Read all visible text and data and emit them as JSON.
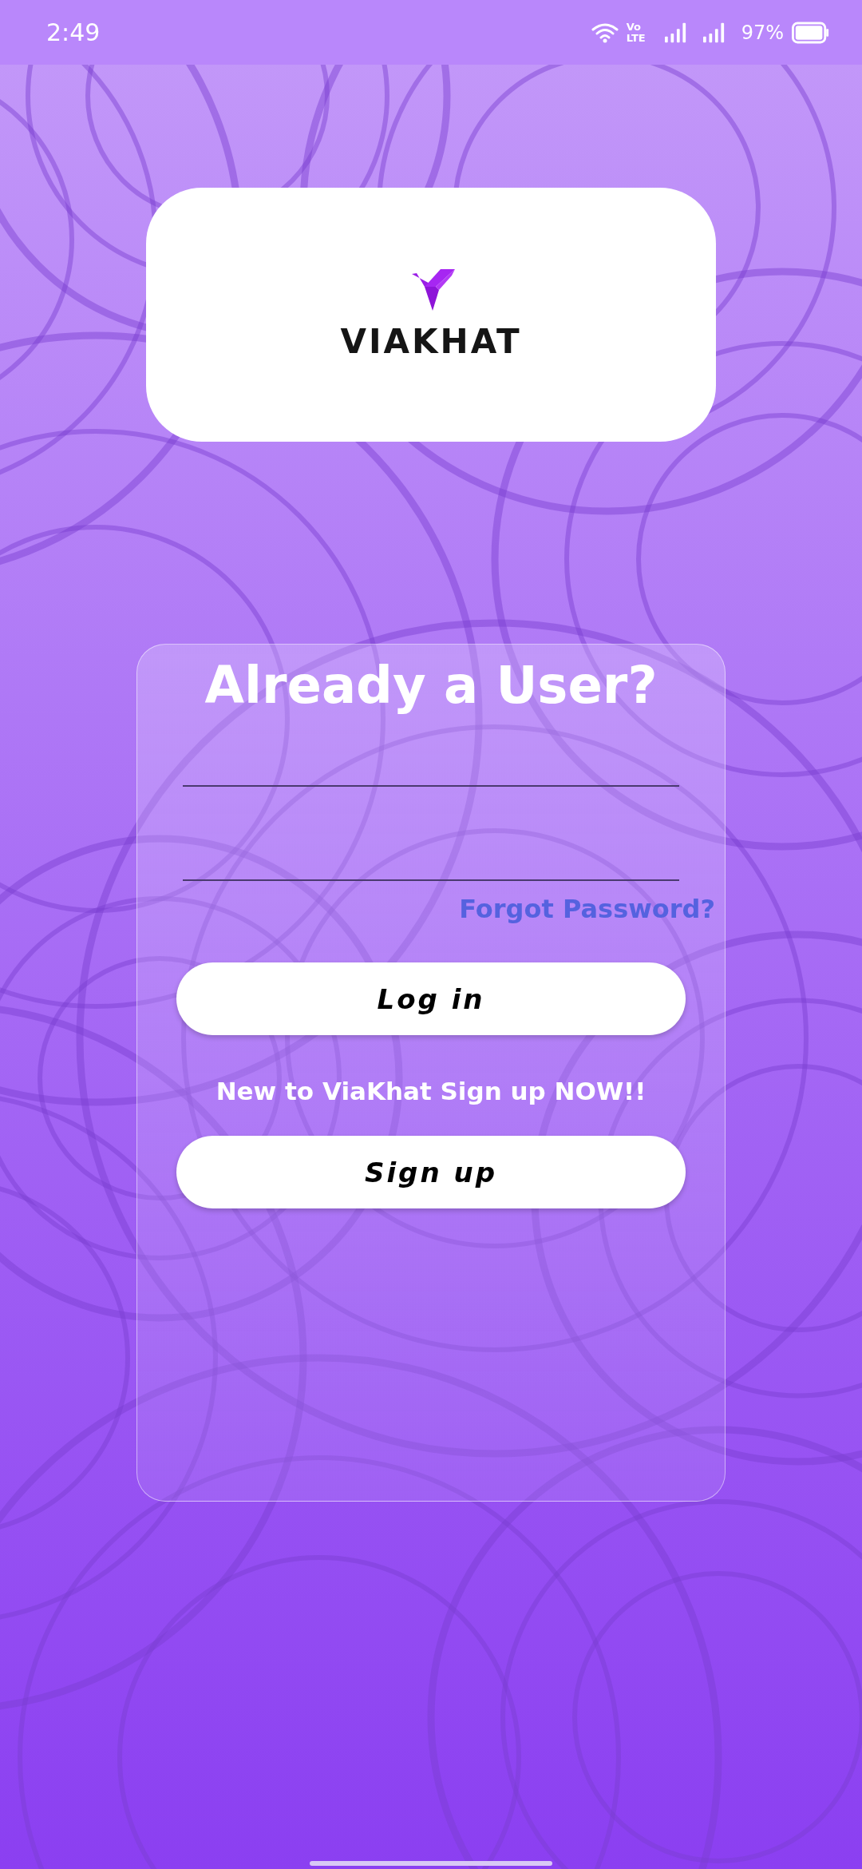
{
  "status_bar": {
    "time": "2:49",
    "network": "Vo\nLTE",
    "battery": "97%"
  },
  "logo": {
    "name": "VIAKHAT"
  },
  "login_card": {
    "title": "Already a User?",
    "fields": [
      {
        "kind": "underline"
      },
      {
        "kind": "underline"
      }
    ],
    "forgot_link": "Forgot Password?",
    "login_button": "Log in",
    "signup_prompt": "New to ViaKhat Sign up NOW!!",
    "signup_button": "Sign up"
  }
}
